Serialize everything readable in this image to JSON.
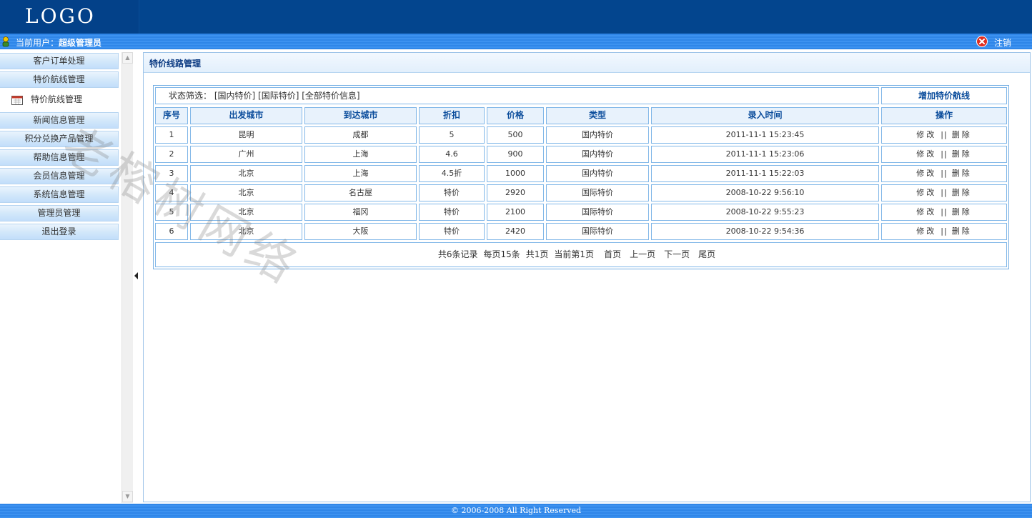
{
  "header": {
    "logo": "LOGO"
  },
  "userbar": {
    "current_user_label": "当前用户：",
    "current_user": "超级管理员",
    "logout": "注销"
  },
  "sidebar": {
    "items": [
      {
        "label": "客户订单处理",
        "active": false
      },
      {
        "label": "特价航线管理",
        "active": false
      },
      {
        "label": "特价航线管理",
        "active": true
      },
      {
        "label": "新闻信息管理",
        "active": false
      },
      {
        "label": "积分兑换产品管理",
        "active": false
      },
      {
        "label": "帮助信息管理",
        "active": false
      },
      {
        "label": "会员信息管理",
        "active": false
      },
      {
        "label": "系统信息管理",
        "active": false
      },
      {
        "label": "管理员管理",
        "active": false
      },
      {
        "label": "退出登录",
        "active": false
      }
    ]
  },
  "main": {
    "title": "特价线路管理",
    "filter": {
      "label": "状态筛选：",
      "options": [
        "[国内特价]",
        "[国际特价]",
        "[全部特价信息]"
      ]
    },
    "add_button": "增加特价航线",
    "table": {
      "headers": [
        "序号",
        "出发城市",
        "到达城市",
        "折扣",
        "价格",
        "类型",
        "录入时间",
        "操作"
      ],
      "rows": [
        [
          "1",
          "昆明",
          "成都",
          "5",
          "500",
          "国内特价",
          "2011-11-1 15:23:45"
        ],
        [
          "2",
          "广州",
          "上海",
          "4.6",
          "900",
          "国内特价",
          "2011-11-1 15:23:06"
        ],
        [
          "3",
          "北京",
          "上海",
          "4.5折",
          "1000",
          "国内特价",
          "2011-11-1 15:22:03"
        ],
        [
          "4",
          "北京",
          "名古屋",
          "特价",
          "2920",
          "国际特价",
          "2008-10-22 9:56:10"
        ],
        [
          "5",
          "北京",
          "福冈",
          "特价",
          "2100",
          "国际特价",
          "2008-10-22 9:55:23"
        ],
        [
          "6",
          "北京",
          "大阪",
          "特价",
          "2420",
          "国际特价",
          "2008-10-22 9:54:36"
        ]
      ],
      "edit_label": "修改",
      "separator": "||",
      "delete_label": "删除"
    },
    "pager": {
      "total": "共6条记录",
      "per_page": "每页15条",
      "pages": "共1页",
      "current": "当前第1页",
      "first": "首页",
      "prev": "上一页",
      "next": "下一页",
      "last": "尾页"
    }
  },
  "watermark": "老榕树网络",
  "footer": {
    "copyright": "© 2006-2008 All Right Reserved"
  },
  "colors": {
    "header_bg": "#03458e",
    "bar_blue": "#3d92f0",
    "title_blue": "#0b4d9c",
    "border_blue": "#81b7e8"
  },
  "icons": {
    "user": "user-icon",
    "logout": "close-circle-icon",
    "menu_active": "calendar-icon"
  }
}
